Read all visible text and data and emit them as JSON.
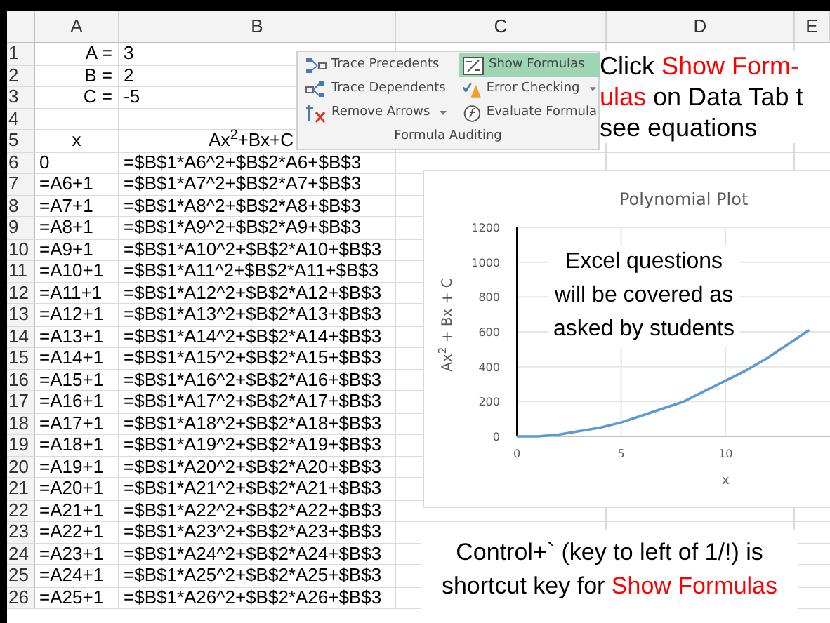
{
  "columns": [
    "A",
    "B",
    "C",
    "D",
    "E"
  ],
  "rows": [
    {
      "num": "1",
      "a": "A =",
      "b": "3",
      "kind": "param"
    },
    {
      "num": "2",
      "a": "B =",
      "b": "2",
      "kind": "param"
    },
    {
      "num": "3",
      "a": "C =",
      "b": "-5",
      "kind": "param"
    },
    {
      "num": "4",
      "a": "",
      "b": "",
      "kind": "blank"
    },
    {
      "num": "5",
      "a": "x",
      "b": "Ax$^{2}$+Bx+C",
      "kind": "header"
    },
    {
      "num": "6",
      "a": "0",
      "b": "=$B$1*A6^2+$B$2*A6+$B$3",
      "kind": "formula"
    },
    {
      "num": "7",
      "a": "=A6+1",
      "b": "=$B$1*A7^2+$B$2*A7+$B$3",
      "kind": "formula"
    },
    {
      "num": "8",
      "a": "=A7+1",
      "b": "=$B$1*A8^2+$B$2*A8+$B$3",
      "kind": "formula"
    },
    {
      "num": "9",
      "a": "=A8+1",
      "b": "=$B$1*A9^2+$B$2*A9+$B$3",
      "kind": "formula"
    },
    {
      "num": "10",
      "a": "=A9+1",
      "b": "=$B$1*A10^2+$B$2*A10+$B$3",
      "kind": "formula"
    },
    {
      "num": "11",
      "a": "=A10+1",
      "b": "=$B$1*A11^2+$B$2*A11+$B$3",
      "kind": "formula"
    },
    {
      "num": "12",
      "a": "=A11+1",
      "b": "=$B$1*A12^2+$B$2*A12+$B$3",
      "kind": "formula"
    },
    {
      "num": "13",
      "a": "=A12+1",
      "b": "=$B$1*A13^2+$B$2*A13+$B$3",
      "kind": "formula"
    },
    {
      "num": "14",
      "a": "=A13+1",
      "b": "=$B$1*A14^2+$B$2*A14+$B$3",
      "kind": "formula"
    },
    {
      "num": "15",
      "a": "=A14+1",
      "b": "=$B$1*A15^2+$B$2*A15+$B$3",
      "kind": "formula"
    },
    {
      "num": "16",
      "a": "=A15+1",
      "b": "=$B$1*A16^2+$B$2*A16+$B$3",
      "kind": "formula"
    },
    {
      "num": "17",
      "a": "=A16+1",
      "b": "=$B$1*A17^2+$B$2*A17+$B$3",
      "kind": "formula"
    },
    {
      "num": "18",
      "a": "=A17+1",
      "b": "=$B$1*A18^2+$B$2*A18+$B$3",
      "kind": "formula"
    },
    {
      "num": "19",
      "a": "=A18+1",
      "b": "=$B$1*A19^2+$B$2*A19+$B$3",
      "kind": "formula"
    },
    {
      "num": "20",
      "a": "=A19+1",
      "b": "=$B$1*A20^2+$B$2*A20+$B$3",
      "kind": "formula"
    },
    {
      "num": "21",
      "a": "=A20+1",
      "b": "=$B$1*A21^2+$B$2*A21+$B$3",
      "kind": "formula"
    },
    {
      "num": "22",
      "a": "=A21+1",
      "b": "=$B$1*A22^2+$B$2*A22+$B$3",
      "kind": "formula"
    },
    {
      "num": "23",
      "a": "=A22+1",
      "b": "=$B$1*A23^2+$B$2*A23+$B$3",
      "kind": "formula"
    },
    {
      "num": "24",
      "a": "=A23+1",
      "b": "=$B$1*A24^2+$B$2*A24+$B$3",
      "kind": "formula"
    },
    {
      "num": "25",
      "a": "=A24+1",
      "b": "=$B$1*A25^2+$B$2*A25+$B$3",
      "kind": "formula"
    },
    {
      "num": "26",
      "a": "=A25+1",
      "b": "=$B$1*A26^2+$B$2*A26+$B$3",
      "kind": "formula"
    }
  ],
  "ribbon": {
    "group_label": "Formula Auditing",
    "buttons": [
      {
        "label": "Trace Precedents",
        "selected": false,
        "dropdown": false
      },
      {
        "label": "Show Formulas",
        "selected": true,
        "dropdown": false
      },
      {
        "label": "Trace Dependents",
        "selected": false,
        "dropdown": false
      },
      {
        "label": "Error Checking",
        "selected": false,
        "dropdown": true
      },
      {
        "label": "Remove Arrows",
        "selected": false,
        "dropdown": true
      },
      {
        "label": "Evaluate Formula",
        "selected": false,
        "dropdown": false
      }
    ]
  },
  "note_top": [
    [
      {
        "text": "Click ",
        "highlight": false
      },
      {
        "text": "Show Form-",
        "highlight": true
      }
    ],
    [
      {
        "text": "ulas",
        "highlight": true
      },
      {
        "text": " on Data Tab t",
        "highlight": false
      }
    ],
    [
      {
        "text": "see equations",
        "highlight": false
      }
    ]
  ],
  "chart": {
    "note": [
      "Excel questions",
      "will be covered as",
      "asked by students"
    ],
    "chart_data": {
      "type": "line",
      "title": "Polynomial Plot",
      "xlabel": "x",
      "ylabel": "Ax$^{2}$ + Bx + C",
      "x": [
        0,
        1,
        2,
        3,
        4,
        5,
        6,
        7,
        8,
        9,
        10,
        11,
        12,
        13,
        14
      ],
      "series": [
        {
          "color": "#5b9bd5",
          "values": [
            0,
            0,
            10,
            30,
            50,
            80,
            120,
            160,
            200,
            260,
            320,
            380,
            450,
            530,
            610
          ]
        }
      ],
      "grid": true,
      "xlim": [
        0,
        15
      ],
      "ylim": [
        0,
        1200
      ],
      "xticks": [
        0,
        5,
        10
      ],
      "yticks": [
        0,
        200,
        400,
        600,
        800,
        1000,
        1200
      ]
    }
  },
  "note_bottom": [
    [
      {
        "text": "Control+` (key to left of 1/!) is",
        "highlight": false
      }
    ],
    [
      {
        "text": "shortcut key for ",
        "highlight": false
      },
      {
        "text": "Show Formulas",
        "highlight": true
      }
    ]
  ]
}
